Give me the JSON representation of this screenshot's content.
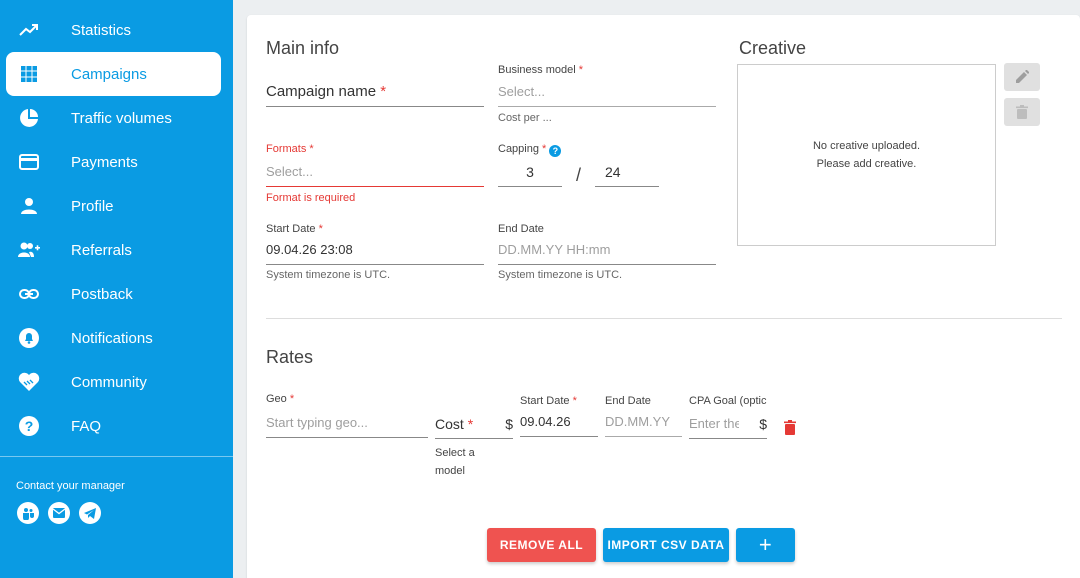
{
  "sidebar": {
    "items": [
      {
        "label": "Statistics",
        "icon": "trending-up-icon"
      },
      {
        "label": "Campaigns",
        "icon": "grid-icon"
      },
      {
        "label": "Traffic volumes",
        "icon": "pie-chart-icon"
      },
      {
        "label": "Payments",
        "icon": "credit-card-icon"
      },
      {
        "label": "Profile",
        "icon": "person-icon"
      },
      {
        "label": "Referrals",
        "icon": "group-add-icon"
      },
      {
        "label": "Postback",
        "icon": "link-icon"
      },
      {
        "label": "Notifications",
        "icon": "bell-icon"
      },
      {
        "label": "Community",
        "icon": "handshake-heart-icon"
      },
      {
        "label": "FAQ",
        "icon": "help-icon"
      }
    ],
    "active": "Campaigns",
    "contact_label": "Contact your manager",
    "social_icons": [
      "teams-icon",
      "mail-icon",
      "telegram-icon"
    ]
  },
  "main_info": {
    "title": "Main info",
    "campaign_name": {
      "value": "Campaign name",
      "required": "*"
    },
    "business_model": {
      "label": "Business model",
      "required": "*",
      "placeholder": "Select...",
      "hint": "Cost per ..."
    },
    "formats": {
      "label": "Formats",
      "required": "*",
      "placeholder": "Select...",
      "error": "Format is required"
    },
    "capping": {
      "label": "Capping",
      "required": "*",
      "help": "?",
      "value1": "3",
      "separator": "/",
      "value2": "24"
    },
    "start_date": {
      "label": "Start Date",
      "required": "*",
      "value": "09.04.26 23:08",
      "hint": "System timezone is UTC."
    },
    "end_date": {
      "label": "End Date",
      "placeholder": "DD.MM.YY HH:mm",
      "hint": "System timezone is UTC."
    }
  },
  "creative": {
    "title": "Creative",
    "empty_line1": "No creative uploaded.",
    "empty_line2": "Please add creative.",
    "edit_icon": "pencil-icon",
    "delete_icon": "trash-icon"
  },
  "rates": {
    "title": "Rates",
    "geo": {
      "label": "Geo",
      "required": "*",
      "placeholder": "Start typing geo..."
    },
    "cost": {
      "label": "Cost",
      "required": "*",
      "currency": "$",
      "hint_line1": "Select a",
      "hint_line2": "model"
    },
    "start_date": {
      "label": "Start Date",
      "required": "*",
      "value": "09.04.26"
    },
    "end_date": {
      "label": "End Date",
      "placeholder": "DD.MM.YY"
    },
    "cpa_goal": {
      "label": "CPA Goal (optic",
      "placeholder": "Enter the",
      "currency": "$"
    }
  },
  "buttons": {
    "remove_all": "REMOVE ALL",
    "import_csv": "IMPORT CSV DATA",
    "add": "+"
  },
  "colors": {
    "brand": "#0a9be3",
    "error": "#e53935",
    "danger_button": "#ef5350"
  }
}
